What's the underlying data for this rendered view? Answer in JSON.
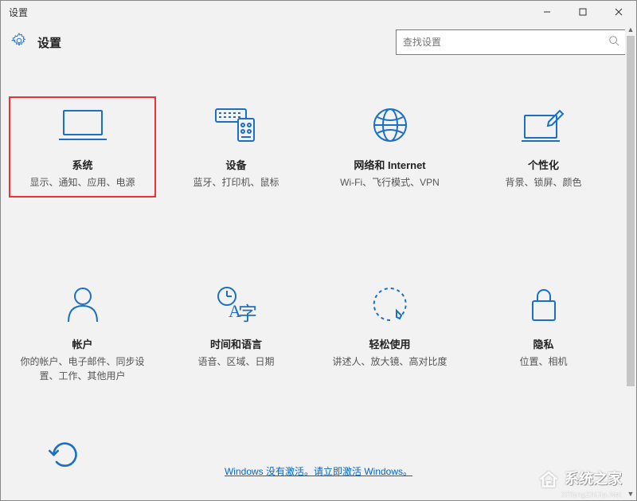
{
  "window": {
    "title": "设置"
  },
  "app": {
    "title": "设置"
  },
  "search": {
    "placeholder": "查找设置"
  },
  "tiles": [
    {
      "title": "系统",
      "desc": "显示、通知、应用、电源",
      "highlight": true
    },
    {
      "title": "设备",
      "desc": "蓝牙、打印机、鼠标"
    },
    {
      "title": "网络和 Internet",
      "desc": "Wi-Fi、飞行模式、VPN"
    },
    {
      "title": "个性化",
      "desc": "背景、锁屏、颜色"
    },
    {
      "title": "帐户",
      "desc": "你的帐户、电子邮件、同步设置、工作、其他用户"
    },
    {
      "title": "时间和语言",
      "desc": "语音、区域、日期"
    },
    {
      "title": "轻松使用",
      "desc": "讲述人、放大镜、高对比度"
    },
    {
      "title": "隐私",
      "desc": "位置、相机"
    }
  ],
  "activation": {
    "text": "Windows 没有激活。请立即激活 Windows。"
  },
  "watermark": {
    "brand": "系统之家",
    "url": "XiTongZhiJia.Net"
  },
  "colors": {
    "accent": "#1b6fc5",
    "highlight_border": "#e33",
    "link": "#0066cc"
  }
}
